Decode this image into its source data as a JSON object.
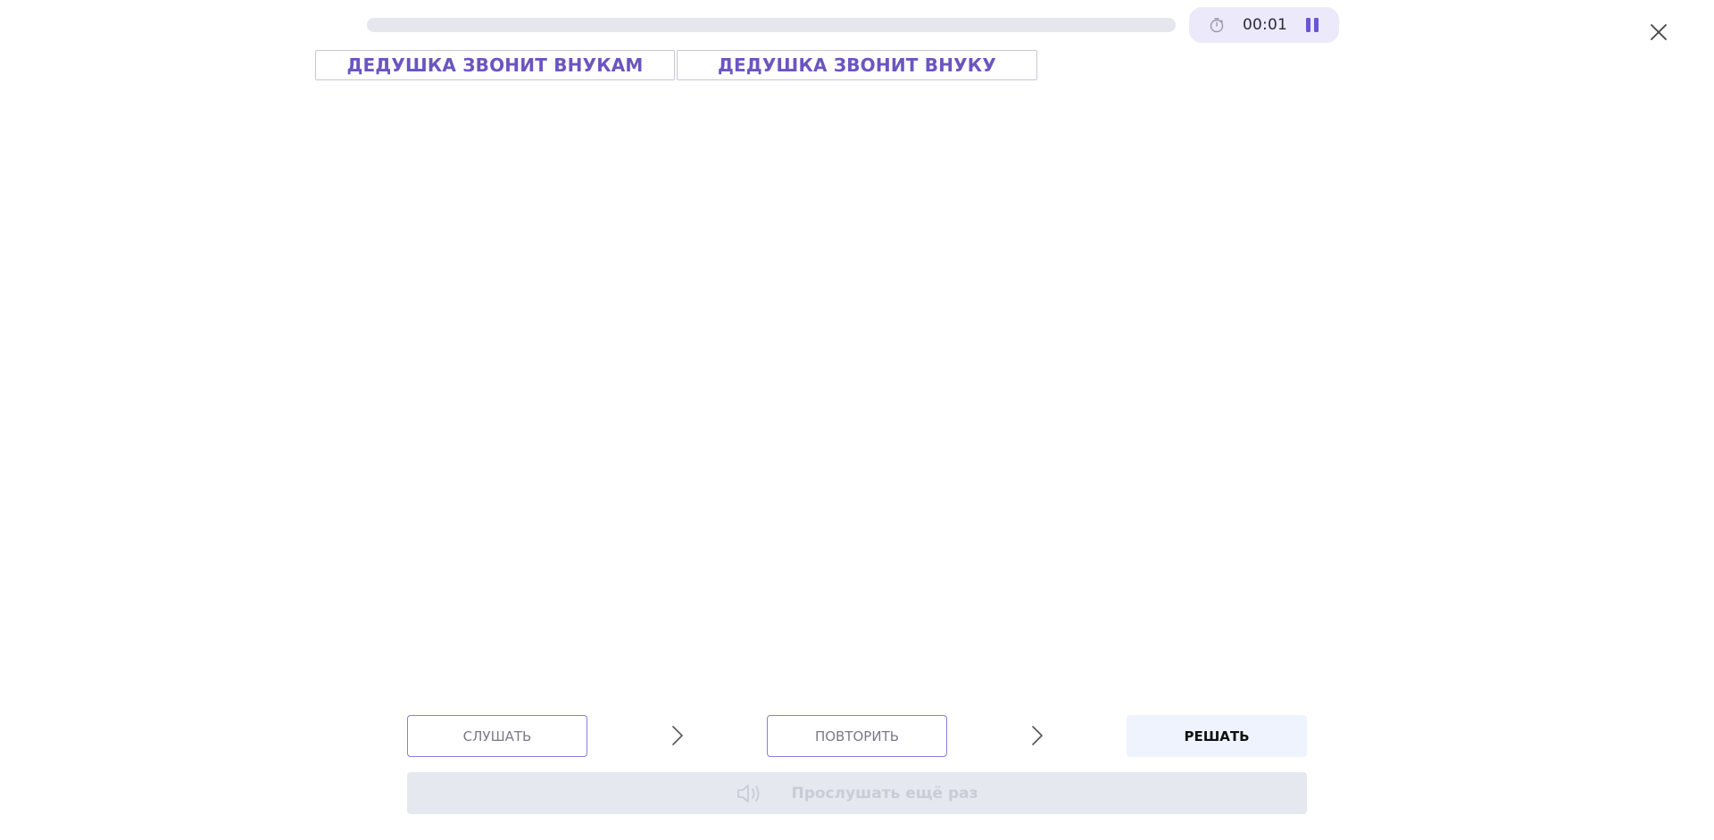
{
  "progress": {
    "value": 0
  },
  "timer": {
    "time": "00:01",
    "clock_icon": "clock-icon",
    "pause_icon": "pause-icon"
  },
  "close": {
    "icon": "close-icon"
  },
  "choices": [
    {
      "label": "ДЕДУШКА ЗВОНИТ ВНУКАМ"
    },
    {
      "label": "ДЕДУШКА ЗВОНИТ ВНУКУ"
    }
  ],
  "steps": {
    "listen": "СЛУШАТЬ",
    "repeat": "ПОВТОРИТЬ",
    "solve": "РЕШАТЬ",
    "separator_icon": "chevron-right-icon"
  },
  "replay": {
    "label": "Прослушать ещё раз",
    "icon": "speaker-icon"
  },
  "colors": {
    "accent": "#6a55c2",
    "timer_bg": "#ece9fb",
    "track": "#e6e6ee",
    "solve_bg": "#eef3fd",
    "replay_bg": "#e5e8ee"
  }
}
